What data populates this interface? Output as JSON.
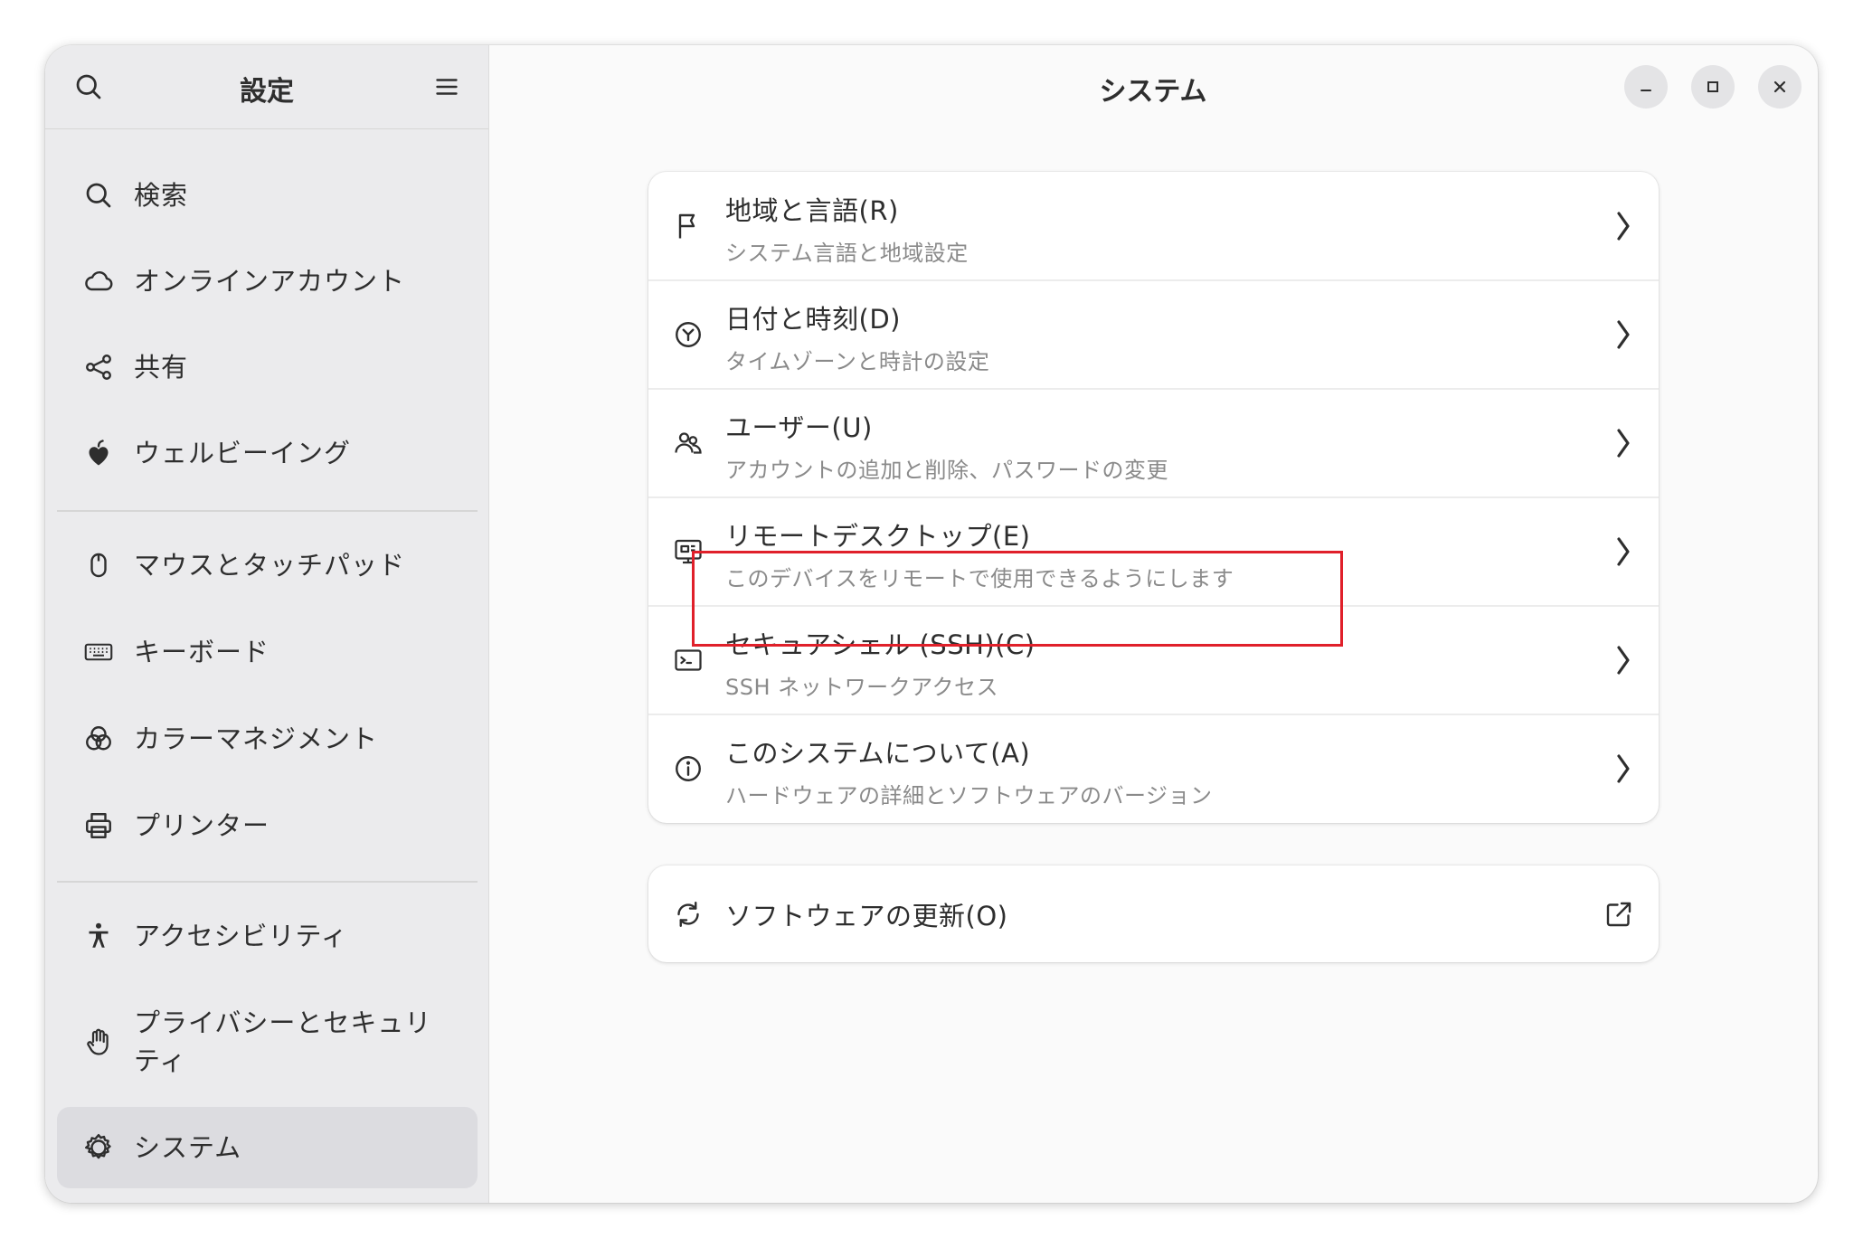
{
  "sidebar": {
    "title": "設定",
    "items": [
      {
        "label": "検索",
        "icon": "search-icon"
      },
      {
        "label": "オンラインアカウント",
        "icon": "cloud-icon"
      },
      {
        "label": "共有",
        "icon": "share-icon"
      },
      {
        "label": "ウェルビーイング",
        "icon": "wellbeing-icon"
      },
      {
        "label": "マウスとタッチパッド",
        "icon": "mouse-icon"
      },
      {
        "label": "キーボード",
        "icon": "keyboard-icon"
      },
      {
        "label": "カラーマネジメント",
        "icon": "color-icon"
      },
      {
        "label": "プリンター",
        "icon": "printer-icon"
      },
      {
        "label": "アクセシビリティ",
        "icon": "accessibility-icon"
      },
      {
        "label": "プライバシーとセキュリティ",
        "icon": "hand-icon"
      },
      {
        "label": "システム",
        "icon": "gear-icon",
        "active": true
      }
    ]
  },
  "main": {
    "title": "システム",
    "rows": [
      {
        "title": "地域と言語(R)",
        "subtitle": "システム言語と地域設定",
        "icon": "flag-icon"
      },
      {
        "title": "日付と時刻(D)",
        "subtitle": "タイムゾーンと時計の設定",
        "icon": "clock-icon"
      },
      {
        "title": "ユーザー(U)",
        "subtitle": "アカウントの追加と削除、パスワードの変更",
        "icon": "users-icon"
      },
      {
        "title": "リモートデスクトップ(E)",
        "subtitle": "このデバイスをリモートで使用できるようにします",
        "icon": "remote-desktop-icon"
      },
      {
        "title": "セキュアシェル (SSH)(C)",
        "subtitle": "SSH ネットワークアクセス",
        "icon": "terminal-icon"
      },
      {
        "title": "このシステムについて(A)",
        "subtitle": "ハードウェアの詳細とソフトウェアのバージョン",
        "icon": "info-icon"
      }
    ],
    "software_update": {
      "label": "ソフトウェアの更新(O)",
      "icon": "refresh-icon"
    }
  },
  "colors": {
    "highlight": "#e0202a",
    "sidebar_bg": "#ebebed",
    "main_bg": "#fafafa"
  }
}
